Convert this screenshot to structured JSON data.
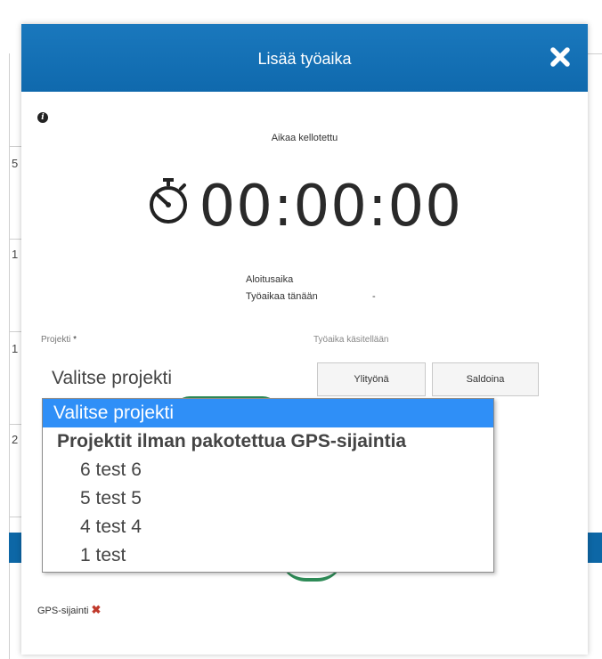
{
  "background": {
    "row_numbers": [
      "5",
      "1",
      "1",
      "2"
    ]
  },
  "modal": {
    "title": "Lisää työaika",
    "close_icon": "close-icon",
    "info_icon": "info-icon"
  },
  "timer": {
    "label": "Aikaa kellotettu",
    "value": "00:00:00",
    "icon": "stopwatch-icon",
    "start_label": "Aloitusaika",
    "today_label": "Työaikaa tänään",
    "today_value": "-"
  },
  "form": {
    "project_label": "Projekti",
    "required_mark": "*",
    "hours_label": "Työaika käsitellään",
    "project_selected": "Valitse projekti",
    "overtime_button": "Ylityönä",
    "balance_button": "Saldoina"
  },
  "dropdown": {
    "selected": "Valitse projekti",
    "group": "Projektit ilman pakotettua GPS-sijaintia",
    "options": [
      "6 test 6",
      "5 test 5",
      "4 test 4",
      "1 test"
    ]
  },
  "gps": {
    "label": "GPS-sijainti",
    "status_icon": "✖"
  },
  "colors": {
    "header": "#1072b5",
    "selected_option": "#2f8ff7",
    "gps_error": "#c0392b"
  }
}
